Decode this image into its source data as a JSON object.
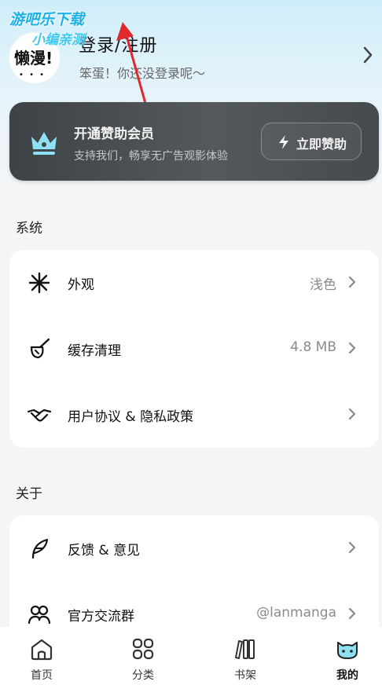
{
  "watermark": {
    "line1": "游吧乐下载",
    "line2": "小编亲测"
  },
  "profile": {
    "avatar_text": "懒漫!",
    "title": "登录/注册",
    "subtitle": "笨蛋！你还没登录呢～"
  },
  "sponsor": {
    "title": "开通赞助会员",
    "description": "支持我们，畅享无广告观影体验",
    "button_label": "立即赞助"
  },
  "system": {
    "section_title": "系统",
    "items": [
      {
        "label": "外观",
        "value": "浅色",
        "icon": "sparkle-icon"
      },
      {
        "label": "缓存清理",
        "value": "4.8 MB",
        "icon": "broom-icon"
      },
      {
        "label": "用户协议 & 隐私政策",
        "value": "",
        "icon": "handshake-icon"
      }
    ]
  },
  "about": {
    "section_title": "关于",
    "items": [
      {
        "label": "反馈 & 意见",
        "value": "",
        "icon": "feather-icon"
      },
      {
        "label": "官方交流群",
        "value": "@lanmanga",
        "icon": "group-icon"
      }
    ]
  },
  "bottom_nav": [
    {
      "label": "首页",
      "icon": "home-icon",
      "active": false
    },
    {
      "label": "分类",
      "icon": "grid-icon",
      "active": false
    },
    {
      "label": "书架",
      "icon": "bookshelf-icon",
      "active": false
    },
    {
      "label": "我的",
      "icon": "cat-face-icon",
      "active": true
    }
  ],
  "colors": {
    "header_gradient_top": "#cfeef9",
    "sponsor_card": "#4a4f52",
    "background": "#f4f5f7",
    "arrow_annotation": "#e0282f"
  }
}
